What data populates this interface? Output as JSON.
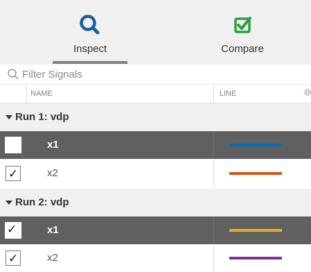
{
  "tabs": [
    {
      "label": "Inspect",
      "icon": "magnifier-icon",
      "active": true,
      "color": "#1b5f9e"
    },
    {
      "label": "Compare",
      "icon": "check-square-icon",
      "active": false,
      "color": "#2f9e3e"
    }
  ],
  "filter": {
    "placeholder": "Filter Signals",
    "value": ""
  },
  "columns": {
    "name": "NAME",
    "line": "LINE"
  },
  "runs": [
    {
      "title": "Run 1: vdp",
      "signals": [
        {
          "name": "x1",
          "checked": false,
          "selected": true,
          "color": "#0072bd"
        },
        {
          "name": "x2",
          "checked": true,
          "selected": false,
          "color": "#d95319"
        }
      ]
    },
    {
      "title": "Run 2: vdp",
      "signals": [
        {
          "name": "x1",
          "checked": true,
          "selected": true,
          "color": "#edb120"
        },
        {
          "name": "x2",
          "checked": true,
          "selected": false,
          "color": "#7e2f8e"
        }
      ]
    }
  ],
  "check_glyph": "✓"
}
